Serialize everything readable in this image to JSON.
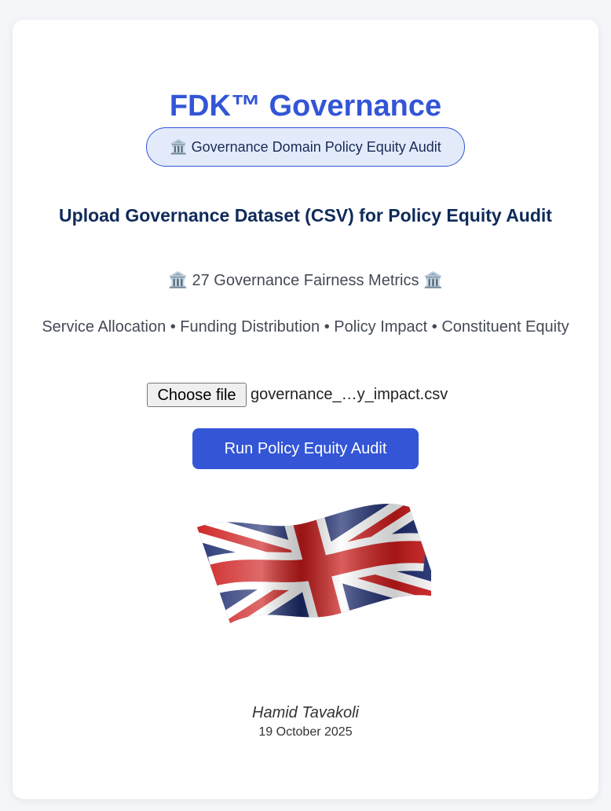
{
  "header": {
    "title": "FDK™ Governance",
    "badge_icon": "🏛️",
    "badge_text": "Governance Domain Policy Equity Audit"
  },
  "upload": {
    "heading": "Upload Governance Dataset (CSV) for Policy Equity Audit",
    "metrics_icon": "🏛️",
    "metrics_text": "27 Governance Fairness Metrics",
    "categories": "Service Allocation • Funding Distribution • Policy Impact • Constituent Equity",
    "file_button_label": "Choose file",
    "file_name": "governance_…y_impact.csv",
    "run_button_label": "Run Policy Equity Audit"
  },
  "footer": {
    "flag_icon": "union-jack-flag",
    "author": "Hamid Tavakoli",
    "date": "19 October 2025"
  },
  "colors": {
    "accent": "#3355d6",
    "heading": "#0f2a5a",
    "badge_bg": "#e3ebfb"
  }
}
